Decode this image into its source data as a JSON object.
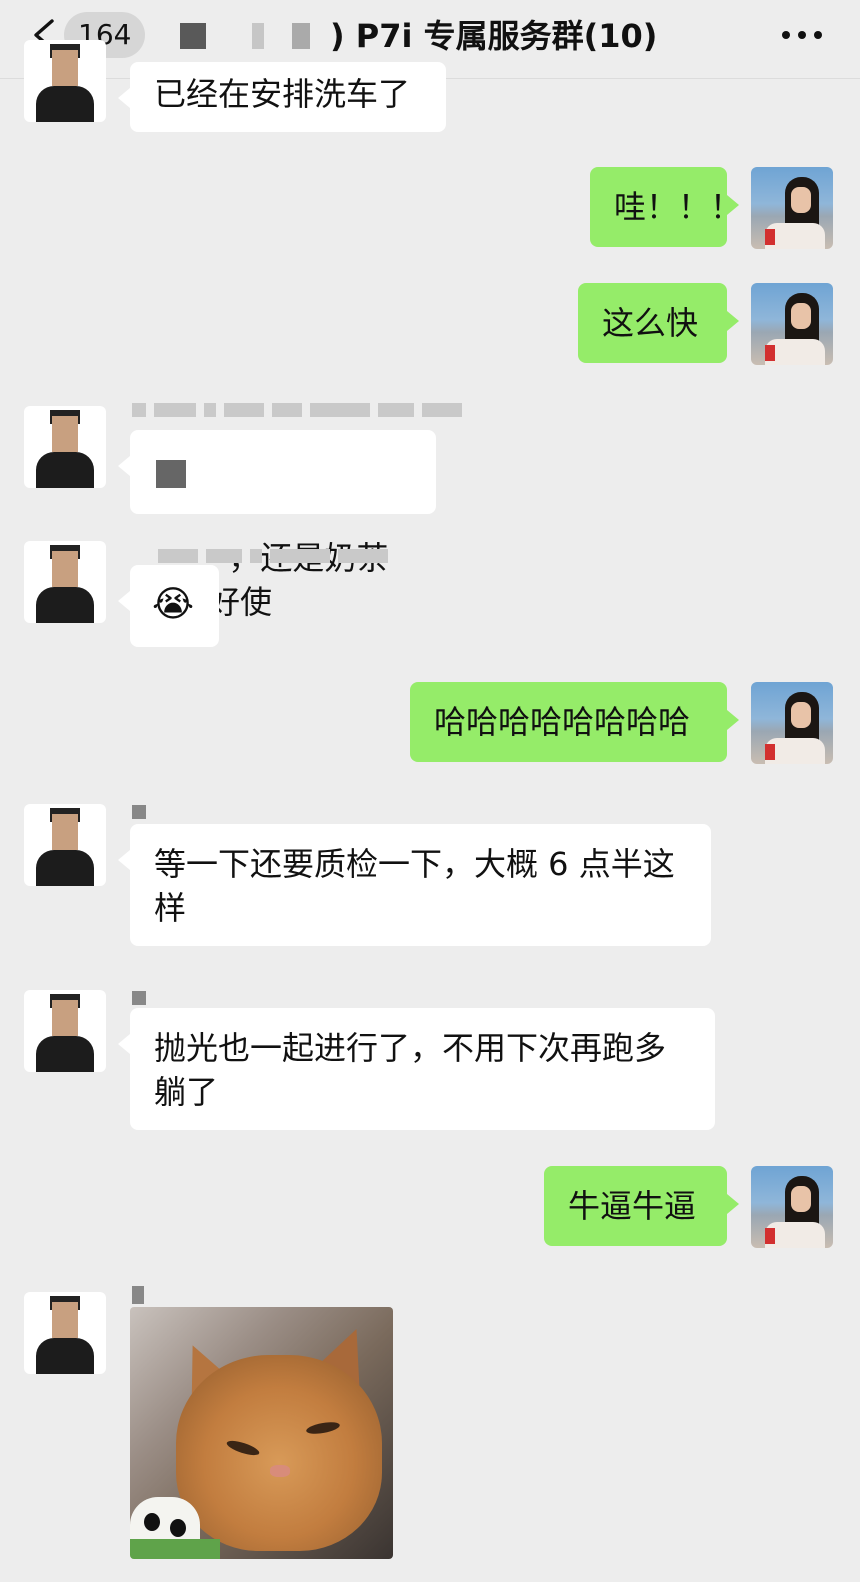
{
  "header": {
    "unread_count": "164",
    "title": ") P7i 专属服务群(10)"
  },
  "messages": [
    {
      "side": "in",
      "text": "已经在安排洗车了"
    },
    {
      "side": "out",
      "text": "哇！！！"
    },
    {
      "side": "out",
      "text": "这么快"
    },
    {
      "side": "in",
      "text": "，还是奶茶好使"
    },
    {
      "side": "in",
      "text": "😭"
    },
    {
      "side": "out",
      "text": "哈哈哈哈哈哈哈哈"
    },
    {
      "side": "in",
      "text": "等一下还要质检一下，大概 6 点半这样"
    },
    {
      "side": "in",
      "text": "抛光也一起进行了，不用下次再跑多躺了"
    },
    {
      "side": "out",
      "text": "牛逼牛逼"
    },
    {
      "side": "in",
      "type": "image",
      "image": "cat-photo"
    }
  ],
  "icons": {
    "back": "back-chevron-icon",
    "more": "more-dots-icon"
  },
  "colors": {
    "background": "#ededed",
    "incoming_bubble": "#ffffff",
    "outgoing_bubble": "#95ec69"
  }
}
